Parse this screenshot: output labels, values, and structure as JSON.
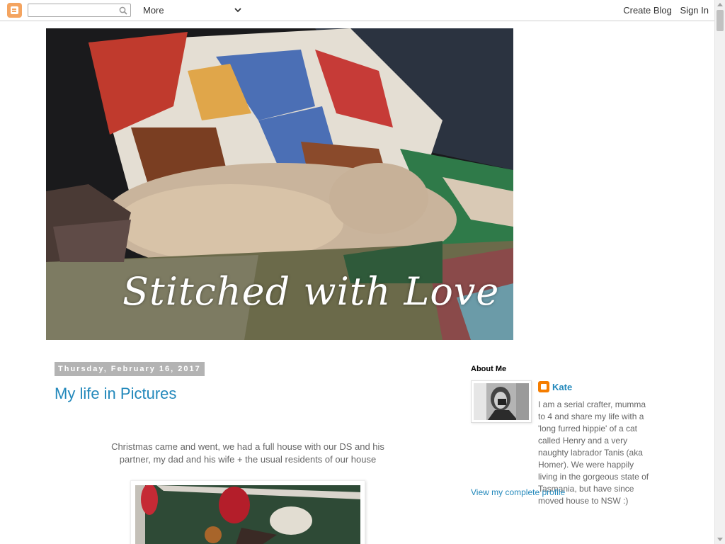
{
  "navbar": {
    "search_placeholder": "",
    "more_label": "More",
    "create_blog": "Create Blog",
    "sign_in": "Sign In"
  },
  "header": {
    "title": "Stitched with Love"
  },
  "post": {
    "date": "Thursday, February 16, 2017",
    "title": "My life in Pictures",
    "body": "Christmas came and went, we had a full house with our DS and his partner, my dad and his wife + the usual residents of our house"
  },
  "sidebar": {
    "section_title": "About Me",
    "profile_name": "Kate",
    "profile_description": "I am a serial crafter, mumma to 4 and share my life with a 'long furred hippie' of a cat called Henry and a very naughty labrador Tanis (aka Homer). We were happily living in the gorgeous state of Tasmania, but have since moved house to NSW :)",
    "profile_link": "View my complete profile"
  },
  "colors": {
    "link": "#2288bb",
    "date_bg": "#b3b3b3",
    "blogger_orange": "#f57d00"
  }
}
